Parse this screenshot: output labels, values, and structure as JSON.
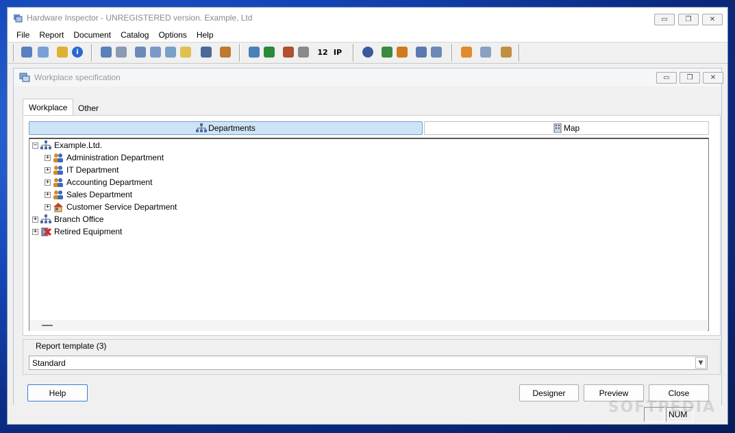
{
  "window": {
    "title": "Hardware Inspector - UNREGISTERED version. Example, Ltd",
    "minimize": "▭",
    "restore": "❐",
    "close": "✕"
  },
  "menu": [
    "File",
    "Report",
    "Document",
    "Catalog",
    "Options",
    "Help"
  ],
  "toolbar": {
    "icons": [
      "workplace-icon",
      "document-icon",
      "help-doc-icon",
      "info-icon",
      "network-icon",
      "list-icon",
      "search-icon",
      "search-doc-icon",
      "search-refresh-icon",
      "magnifier-icon",
      "eye-icon",
      "user-search-icon",
      "computers-icon",
      "card-icon",
      "books-icon",
      "printer-icon",
      "numbers-icon",
      "ip-icon",
      "person-icon",
      "user-add-icon",
      "chart-icon",
      "server-icon",
      "refresh-doc-icon",
      "report-icon",
      "monitor-icon",
      "tools-icon"
    ],
    "numbers_label": "12",
    "ip_label": "IP"
  },
  "mdi": {
    "title": "Workplace specification"
  },
  "tabs": [
    "Workplace",
    "Other"
  ],
  "views": {
    "departments": "Departments",
    "map": "Map"
  },
  "tree": {
    "root": "Example.Ltd.",
    "departments": [
      "Administration Department",
      "IT Department",
      "Accounting Department",
      "Sales Department",
      "Customer Service Department"
    ],
    "branch": "Branch Office",
    "retired": "Retired Equipment"
  },
  "report_template": {
    "label": "Report template (3)",
    "selected": "Standard"
  },
  "buttons": {
    "help": "Help",
    "designer": "Designer",
    "preview": "Preview",
    "close": "Close"
  },
  "status": {
    "num": "NUM"
  },
  "watermark": "SOFTPEDIA",
  "colors": {
    "accent": "#cde4f7",
    "accent_border": "#7a9cc6",
    "people_icon": "#d08a2a"
  }
}
